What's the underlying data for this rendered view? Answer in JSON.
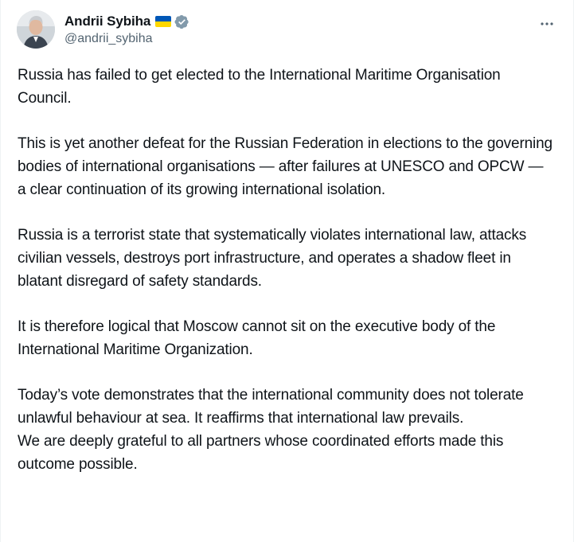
{
  "author": {
    "display_name": "Andrii Sybiha",
    "handle": "@andrii_sybiha",
    "flag_colors": [
      "#0057b7",
      "#ffd700"
    ],
    "verified_badge_color": "#829aab"
  },
  "icons": {
    "avatar": "profile-photo",
    "verified": "verified-badge-icon",
    "more": "more-horizontal-icon"
  },
  "tweet": {
    "paragraphs": [
      "Russia has failed to get elected to the International Maritime Organisation Council.",
      "This is yet another defeat for the Russian Federation in elections to the governing bodies of international organisations — after failures at UNESCO and OPCW — a clear continuation of its growing international isolation.",
      "Russia is a terrorist state that systematically violates international law, attacks civilian vessels, destroys port infrastructure, and operates a shadow fleet in blatant disregard of safety standards.",
      "It is therefore logical that Moscow cannot sit on the executive body of the International Maritime Organization.",
      "Today’s vote demonstrates that the international community does not tolerate unlawful behaviour at sea. It reaffirms that international law prevails.",
      "We are deeply grateful to all partners whose coordinated efforts made this outcome possible."
    ]
  }
}
